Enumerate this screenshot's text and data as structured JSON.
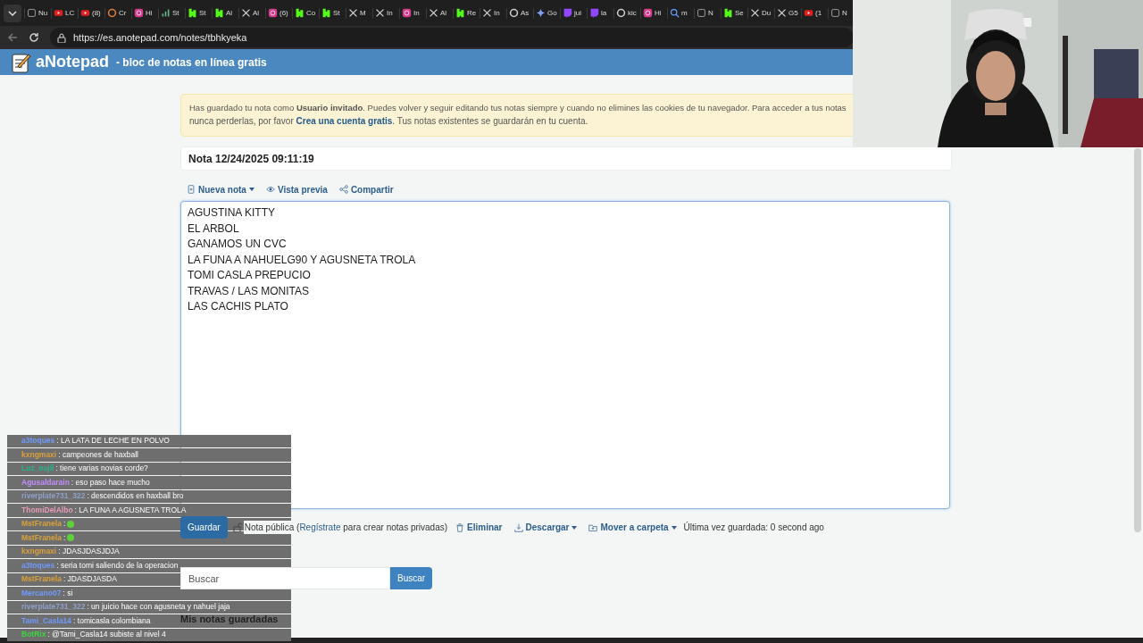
{
  "browser": {
    "tabs": [
      {
        "kind": "page",
        "title": "Nu"
      },
      {
        "kind": "youtube",
        "title": "LC"
      },
      {
        "kind": "youtube",
        "title": "(8)"
      },
      {
        "kind": "spiral",
        "title": "Cr"
      },
      {
        "kind": "instagram",
        "title": "Hi"
      },
      {
        "kind": "chart",
        "title": "St"
      },
      {
        "kind": "kick",
        "title": "St"
      },
      {
        "kind": "kick",
        "title": "Al"
      },
      {
        "kind": "x",
        "title": "Al"
      },
      {
        "kind": "instagram",
        "title": "(6)"
      },
      {
        "kind": "kick",
        "title": "Co"
      },
      {
        "kind": "kick",
        "title": "St"
      },
      {
        "kind": "x",
        "title": "M"
      },
      {
        "kind": "x",
        "title": "In"
      },
      {
        "kind": "instagram",
        "title": "In"
      },
      {
        "kind": "x",
        "title": "Al"
      },
      {
        "kind": "kick",
        "title": "Re"
      },
      {
        "kind": "x",
        "title": "In"
      },
      {
        "kind": "google",
        "title": "As"
      },
      {
        "kind": "gemini",
        "title": "Go"
      },
      {
        "kind": "twitch",
        "title": "jui"
      },
      {
        "kind": "twitch",
        "title": "la"
      },
      {
        "kind": "google",
        "title": "kic"
      },
      {
        "kind": "instagram",
        "title": "Hi"
      },
      {
        "kind": "search",
        "title": "m"
      },
      {
        "kind": "page",
        "title": "N"
      },
      {
        "kind": "kick",
        "title": "Se"
      },
      {
        "kind": "x",
        "title": "Du"
      },
      {
        "kind": "x",
        "title": "G5"
      },
      {
        "kind": "youtube",
        "title": "(1"
      },
      {
        "kind": "page",
        "title": "N"
      }
    ],
    "url": "https://es.anotepad.com/notes/tbhkyeka"
  },
  "header": {
    "logo": "aNotepad",
    "tagline": "- bloc de notas en línea gratis"
  },
  "notice": {
    "line_1": "Has guardado tu nota como **Usuario invitado**. Puedes volver y seguir editando tus notas siempre y cuando no elimines las cookies de tu navegador. Para acceder a tus notas",
    "line_2_before": "nunca perderlas, por favor ",
    "link": "Crea una cuenta gratis",
    "line_2_after": ". Tus notas existentes se guardarán en tu cuenta."
  },
  "note": {
    "title": "Nota 12/24/2025 09:11:19",
    "toolbar": [
      {
        "kind": "new",
        "label": "Nueva nota",
        "dropdown": true
      },
      {
        "kind": "preview",
        "label": "Vista previa",
        "dropdown": false
      },
      {
        "kind": "share",
        "label": "Compartir",
        "dropdown": false
      }
    ],
    "lines": [
      "AGUSTINA KITTY",
      "EL ARBOL",
      "GANAMOS UN CVC",
      "LA FUNA A NAHUELG90 Y AGUSNETA TROLA",
      "TOMI CASLA PREPUCIO",
      "TRAVAS / LAS MONITAS",
      "LAS CACHIS PLATO"
    ]
  },
  "actions": {
    "save": "Guardar",
    "public_before": "Nota pública (",
    "public_link": "Regístrate",
    "public_after": " para crear notas privadas)",
    "menu": [
      {
        "kind": "delete",
        "label": "Eliminar",
        "dropdown": false
      },
      {
        "kind": "download",
        "label": "Descargar",
        "dropdown": true
      },
      {
        "kind": "folder",
        "label": "Mover a carpeta",
        "dropdown": true
      }
    ],
    "last_saved": "Última vez guardada: 0 second ago"
  },
  "search": {
    "placeholder": "Buscar",
    "button": "Buscar"
  },
  "saved_heading": "Mis notas guardadas",
  "chat": [
    {
      "user": "a3toques",
      "color": "#6f9bff",
      "kind": "text",
      "text": ": LA LATA DE LECHE EN POLVO"
    },
    {
      "user": "kxngmaxi",
      "color": "#d9a13b",
      "kind": "text",
      "text": ": campeones de haxball"
    },
    {
      "user": "Luz_oajil",
      "color": "#27b38a",
      "kind": "text",
      "text": ": tiene varias novias corde?"
    },
    {
      "user": "Agusaldarain",
      "color": "#c58cff",
      "kind": "text",
      "text": ": eso paso hace mucho"
    },
    {
      "user": "riverplate731_322",
      "color": "#8ea0c9",
      "kind": "text",
      "text": ": descendidos en haxball bro"
    },
    {
      "user": "ThomiDelAlbo",
      "color": "#e79ab7",
      "kind": "text",
      "text": ": LA FUNA A AGUSNETA TROLA"
    },
    {
      "user": "MstFranela",
      "color": "#d9a13b",
      "kind": "emote",
      "text": ":"
    },
    {
      "user": "MstFranela",
      "color": "#d9a13b",
      "kind": "emote",
      "text": ":"
    },
    {
      "user": "kxngmaxi",
      "color": "#d9a13b",
      "kind": "text",
      "text": ": JDASJDASJDJA"
    },
    {
      "user": "a3toques",
      "color": "#6f9bff",
      "kind": "text",
      "text": ": seria tomi saliendo de la operacion"
    },
    {
      "user": "MstFranela",
      "color": "#d9a13b",
      "kind": "text",
      "text": ": JDASDJASDA"
    },
    {
      "user": "Mercano07",
      "color": "#6f9bff",
      "kind": "text",
      "text": ": si"
    },
    {
      "user": "riverplate731_322",
      "color": "#8ea0c9",
      "kind": "text",
      "text": ": un juicio hace con agusneta y nahuel jaja"
    },
    {
      "user": "Tami_Casla14",
      "color": "#6f9bff",
      "kind": "text",
      "text": ": tomicasla colombiana"
    },
    {
      "user": "BotRix",
      "color": "#3cd63c",
      "kind": "text",
      "text": ": @Tami_Casla14 subiste al nivel 4"
    }
  ]
}
